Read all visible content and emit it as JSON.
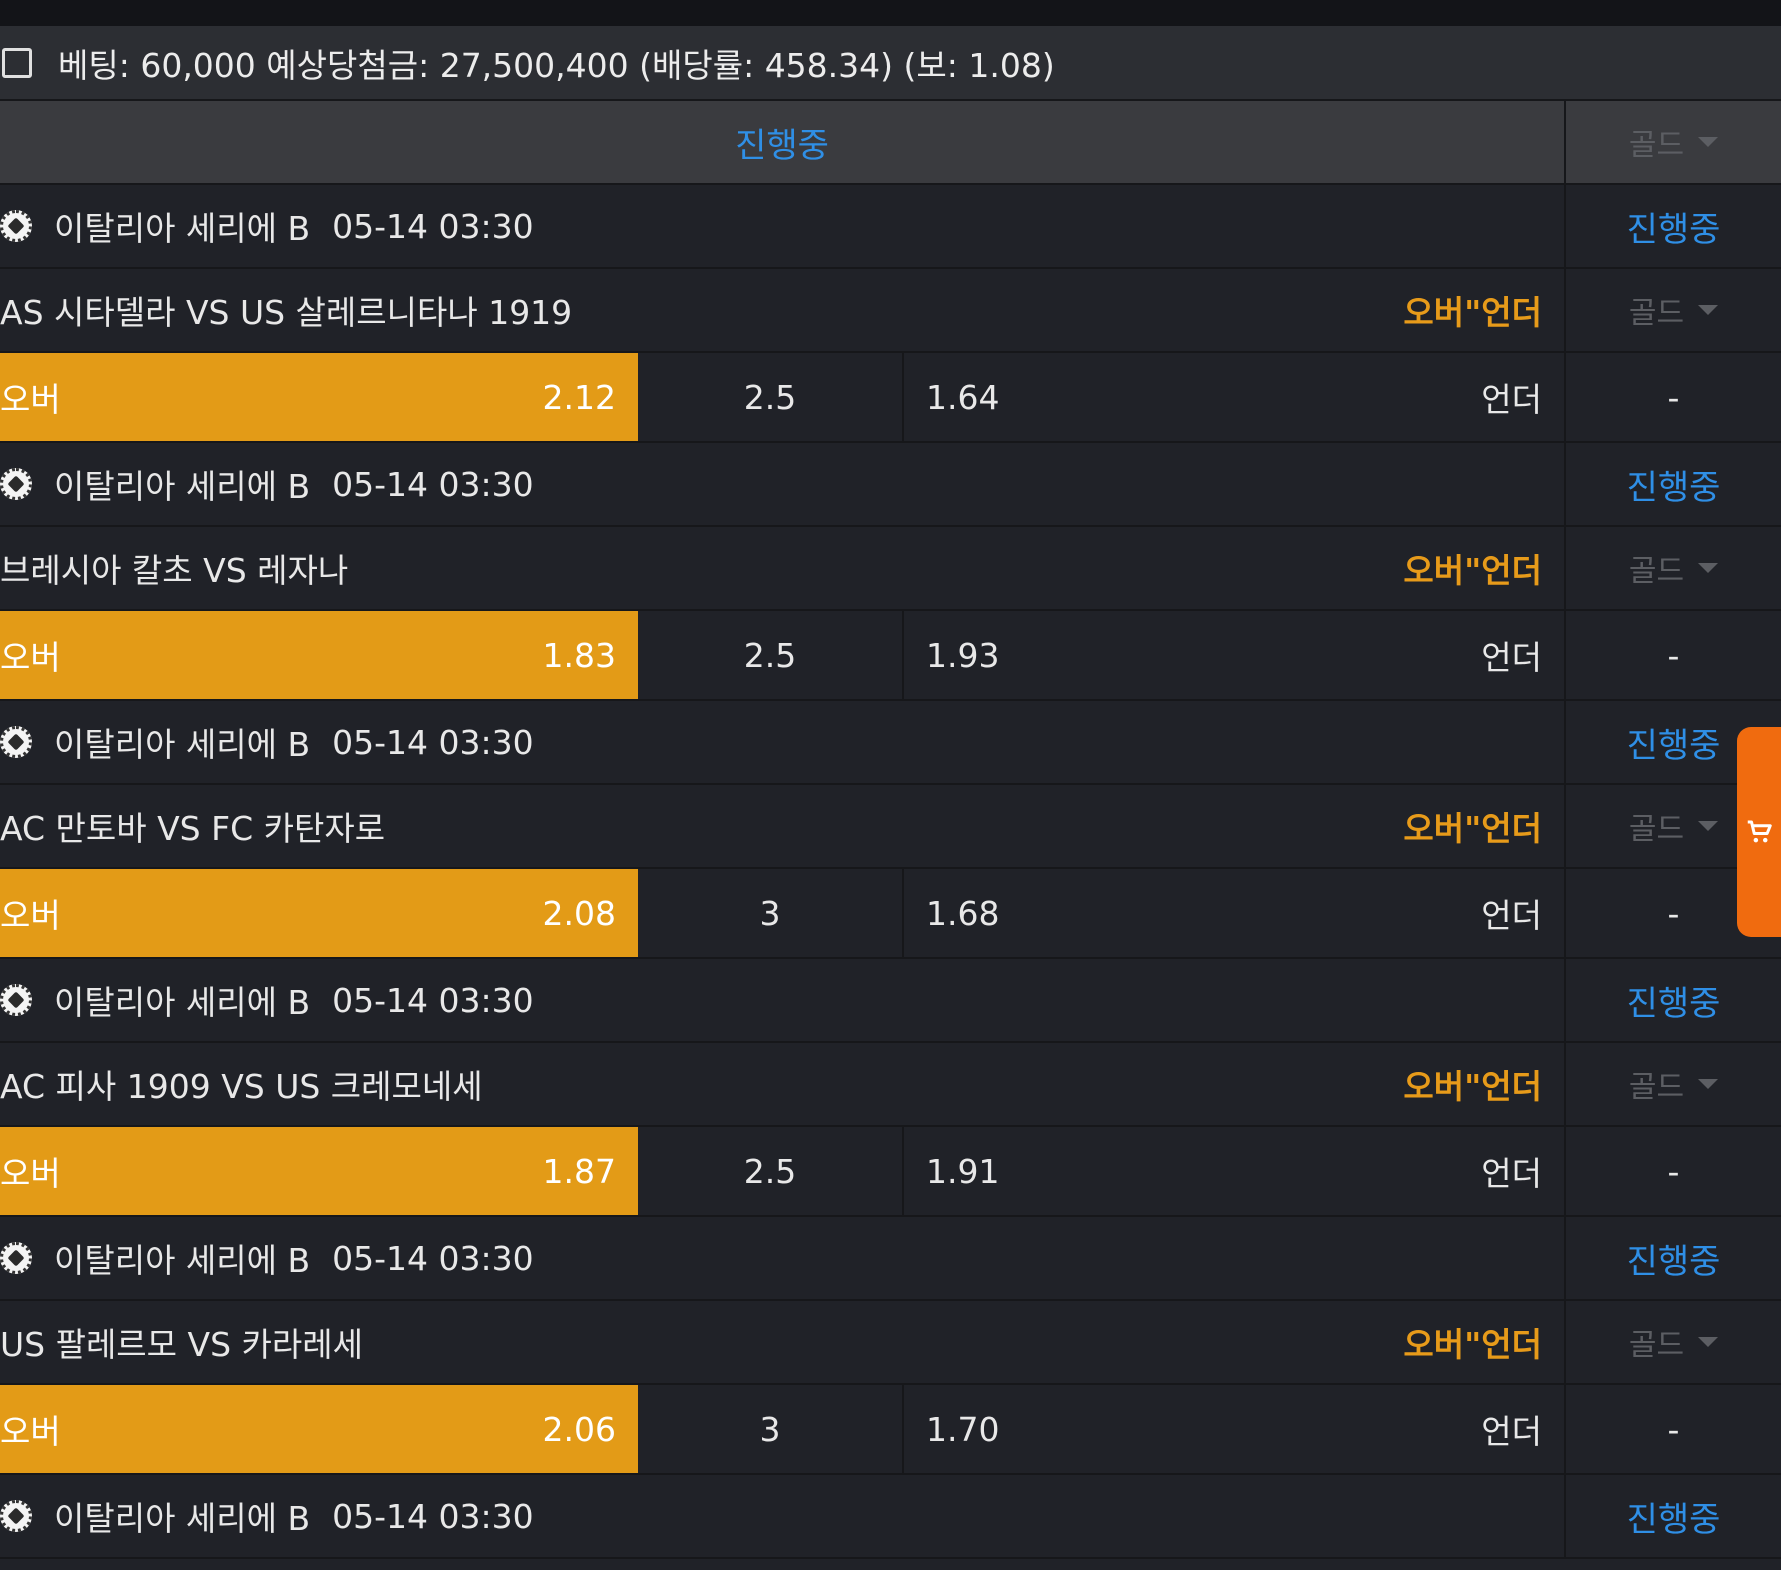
{
  "summary": {
    "text": "베팅: 60,000 예상당첨금: 27,500,400 (배당률: 458.34) (보: 1.08)"
  },
  "header": {
    "status": "진행중",
    "dropdown": "골드"
  },
  "colors": {
    "accent_orange": "#e39b17",
    "status_blue": "#2f8fe6",
    "cart_orange": "#f06b0f"
  },
  "games": [
    {
      "league": "이탈리아 세리에 B",
      "time": "05-14 03:30",
      "status": "진행중",
      "match": "AS 시타델라 VS US 살레르니타나 1919",
      "market": "오버\"언더",
      "dropdown": "골드",
      "over_label": "오버",
      "over_odds": "2.12",
      "line": "2.5",
      "under_odds": "1.64",
      "under_label": "언더",
      "extra": "-"
    },
    {
      "league": "이탈리아 세리에 B",
      "time": "05-14 03:30",
      "status": "진행중",
      "match": "브레시아 칼초 VS 레자나",
      "market": "오버\"언더",
      "dropdown": "골드",
      "over_label": "오버",
      "over_odds": "1.83",
      "line": "2.5",
      "under_odds": "1.93",
      "under_label": "언더",
      "extra": "-"
    },
    {
      "league": "이탈리아 세리에 B",
      "time": "05-14 03:30",
      "status": "진행중",
      "match": "AC 만토바 VS FC 카탄자로",
      "market": "오버\"언더",
      "dropdown": "골드",
      "over_label": "오버",
      "over_odds": "2.08",
      "line": "3",
      "under_odds": "1.68",
      "under_label": "언더",
      "extra": "-"
    },
    {
      "league": "이탈리아 세리에 B",
      "time": "05-14 03:30",
      "status": "진행중",
      "match": "AC 피사 1909 VS US 크레모네세",
      "market": "오버\"언더",
      "dropdown": "골드",
      "over_label": "오버",
      "over_odds": "1.87",
      "line": "2.5",
      "under_odds": "1.91",
      "under_label": "언더",
      "extra": "-"
    },
    {
      "league": "이탈리아 세리에 B",
      "time": "05-14 03:30",
      "status": "진행중",
      "match": "US 팔레르모 VS 카라레세",
      "market": "오버\"언더",
      "dropdown": "골드",
      "over_label": "오버",
      "over_odds": "2.06",
      "line": "3",
      "under_odds": "1.70",
      "under_label": "언더",
      "extra": "-"
    }
  ],
  "last_league": {
    "league": "이탈리아 세리에 B",
    "time": "05-14 03:30",
    "status": "진행중"
  },
  "cart": {
    "icon": "cart-icon"
  }
}
